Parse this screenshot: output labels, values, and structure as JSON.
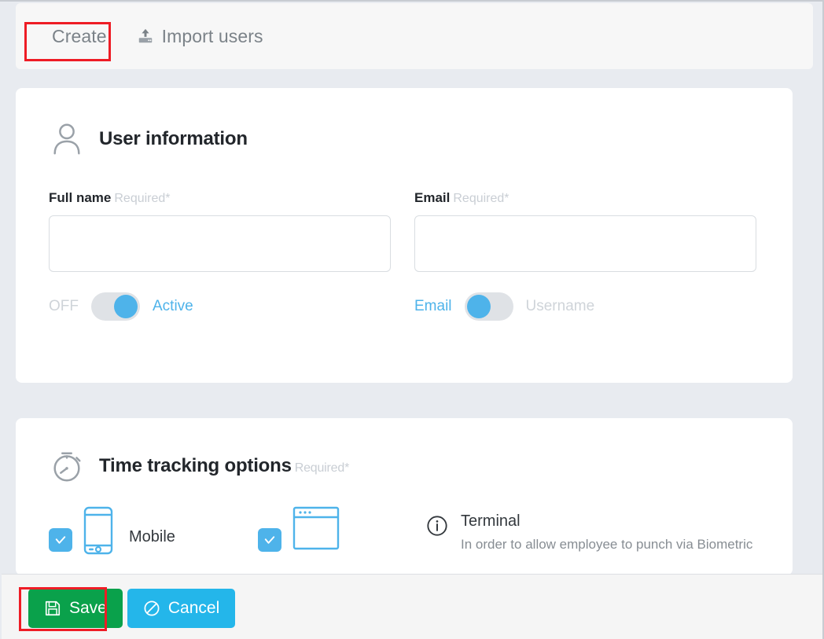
{
  "tabs": [
    {
      "id": "create",
      "label": "Create",
      "icon": null,
      "active": true,
      "highlighted": true
    },
    {
      "id": "import-users",
      "label": "Import users",
      "icon": "upload-icon",
      "active": false,
      "highlighted": false
    }
  ],
  "user_card": {
    "icon": "user-icon",
    "title": "User information",
    "fields": [
      {
        "id": "full-name",
        "label": "Full name",
        "required_tag": "Required*",
        "value": "",
        "placeholder": ""
      },
      {
        "id": "email",
        "label": "Email",
        "required_tag": "Required*",
        "value": "",
        "placeholder": ""
      }
    ],
    "toggles": [
      {
        "id": "active-status",
        "left_label": "OFF",
        "right_label": "Active",
        "knob_side": "right",
        "active_label": "right"
      },
      {
        "id": "login-type",
        "left_label": "Email",
        "right_label": "Username",
        "knob_side": "left",
        "active_label": "left"
      }
    ]
  },
  "time_card": {
    "icon": "stopwatch-icon",
    "title": "Time tracking options",
    "required_tag": "Required*",
    "options": [
      {
        "id": "mobile",
        "label": "Mobile",
        "icon": "mobile-phone-icon",
        "checked": true
      },
      {
        "id": "web",
        "label": "",
        "icon": "browser-window-icon",
        "checked": true
      }
    ],
    "terminal": {
      "id": "terminal",
      "icon": "info-icon",
      "title": "Terminal",
      "description": "In order to allow employee to punch via Biometric"
    }
  },
  "footer": {
    "buttons": [
      {
        "id": "save",
        "label": "Save",
        "icon": "floppy-disk-icon",
        "color": "#0aa14b",
        "highlighted": true
      },
      {
        "id": "cancel",
        "label": "Cancel",
        "icon": "no-entry-icon",
        "color": "#24b6ea",
        "highlighted": false
      }
    ]
  },
  "colors": {
    "background": "#e8ebf0",
    "card": "#ffffff",
    "accent_blue": "#4eb3ea",
    "save_green": "#0aa14b",
    "cancel_blue": "#24b6ea",
    "highlight_red": "#ee1c25",
    "muted_text": "#c9ced4"
  }
}
